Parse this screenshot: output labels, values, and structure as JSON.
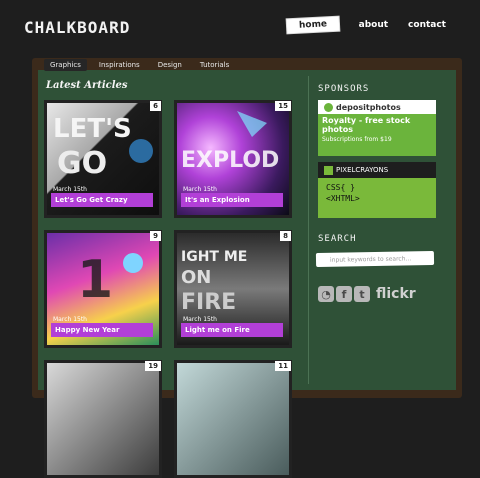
{
  "brand": {
    "logo_text": "CHALKBOARD"
  },
  "topnav": {
    "items": [
      "home",
      "about",
      "contact"
    ],
    "active": "home"
  },
  "subnav": {
    "tabs": [
      "Graphics",
      "Inspirations",
      "Design",
      "Tutorials"
    ],
    "active": "Graphics"
  },
  "main": {
    "heading": "Latest Articles",
    "articles": [
      {
        "badge": "6",
        "date": "March 15th",
        "title": "Let's Go Get Crazy"
      },
      {
        "badge": "15",
        "date": "March 15th",
        "title": "It's an Explosion"
      },
      {
        "badge": "9",
        "date": "March 15th",
        "title": "Happy New Year"
      },
      {
        "badge": "8",
        "date": "March 15th",
        "title": "Light me on Fire"
      },
      {
        "badge": "19"
      },
      {
        "badge": "11"
      }
    ]
  },
  "sidebar": {
    "sponsors_heading": "SPONSORS",
    "ad1": {
      "brand": "depositphotos",
      "headline": "Royalty - free stock photos",
      "sub": "Subscriptions from $19"
    },
    "ad2": {
      "brand": "PIXELCRAYONS",
      "line1": "CSS{ }",
      "line2": "<XHTML>"
    },
    "search_heading": "SEARCH",
    "search_placeholder": "input keywords to search...",
    "social_icons": [
      "rss-icon",
      "facebook-icon",
      "twitter-icon"
    ],
    "flickr": "flickr"
  }
}
